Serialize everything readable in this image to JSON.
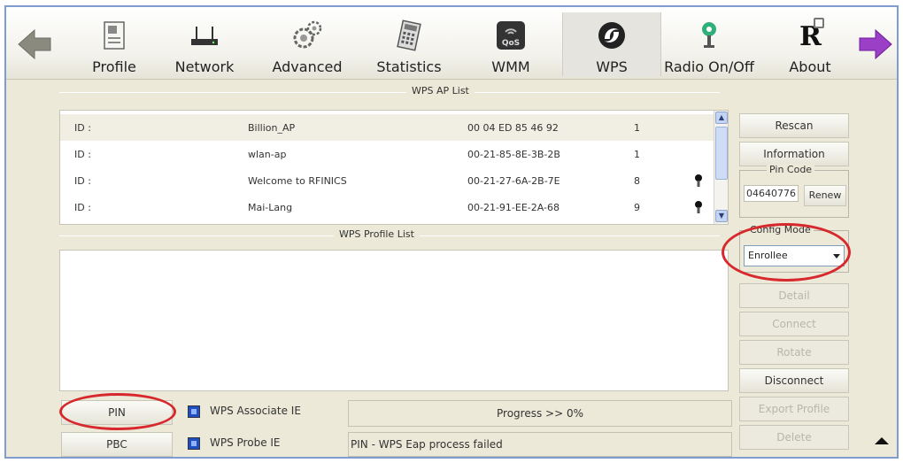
{
  "toolbar": {
    "items": [
      {
        "label": "Profile",
        "icon": "profile-icon"
      },
      {
        "label": "Network",
        "icon": "network-icon"
      },
      {
        "label": "Advanced",
        "icon": "advanced-icon"
      },
      {
        "label": "Statistics",
        "icon": "statistics-icon"
      },
      {
        "label": "WMM",
        "icon": "wmm-icon",
        "badge": "QoS"
      },
      {
        "label": "WPS",
        "icon": "wps-icon",
        "active": true
      },
      {
        "label": "Radio On/Off",
        "icon": "radio-icon"
      },
      {
        "label": "About",
        "icon": "about-icon",
        "badge": "R"
      }
    ]
  },
  "ap_list": {
    "title": "WPS AP List",
    "rows": [
      {
        "id": "ID :",
        "ssid": "Billion_AP",
        "bssid": "00 04 ED 85 46 92",
        "channel": "1",
        "locked": false
      },
      {
        "id": "ID :",
        "ssid": "wlan-ap",
        "bssid": "00-21-85-8E-3B-2B",
        "channel": "1",
        "locked": false
      },
      {
        "id": "ID :",
        "ssid": "Welcome to RFINICS",
        "bssid": "00-21-27-6A-2B-7E",
        "channel": "8",
        "locked": true
      },
      {
        "id": "ID :",
        "ssid": "Mai-Lang",
        "bssid": "00-21-91-EE-2A-68",
        "channel": "9",
        "locked": true
      }
    ]
  },
  "profile_list": {
    "title": "WPS Profile List"
  },
  "side": {
    "rescan": "Rescan",
    "information": "Information",
    "pin_code_label": "Pin Code",
    "pin_code": "04640776",
    "renew": "Renew",
    "config_mode_label": "Config Mode",
    "config_mode_value": "Enrollee",
    "detail": "Detail",
    "connect": "Connect",
    "rotate": "Rotate",
    "disconnect": "Disconnect",
    "export_profile": "Export Profile",
    "delete": "Delete"
  },
  "bottom": {
    "pin": "PIN",
    "pbc": "PBC",
    "wps_associate_ie": "WPS Associate IE",
    "wps_probe_ie": "WPS Probe IE",
    "progress": "Progress >> 0%",
    "status": "PIN - WPS Eap process failed"
  },
  "colors": {
    "highlight": "#d6282d",
    "frame": "#7f9ccf",
    "panel": "#ece9d8"
  }
}
